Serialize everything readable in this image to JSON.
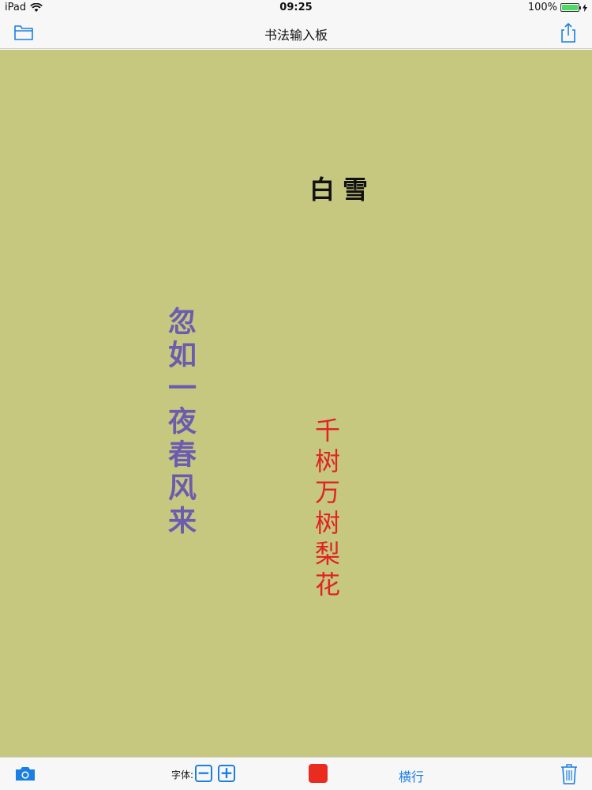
{
  "status_bar": {
    "device": "iPad",
    "time": "09:25",
    "battery": "100%",
    "battery_level": 1.0
  },
  "nav_bar": {
    "title": "书法输入板",
    "left_icon": "folder-icon",
    "right_icon": "share-icon"
  },
  "canvas": {
    "background_color": "#c6c87f",
    "title": "白雪",
    "line1": "忽如一夜春风来",
    "line1_color": "#6b5cb0",
    "line2": "千树万树梨花",
    "line2_color": "#e02424"
  },
  "toolbar": {
    "camera_icon": "camera-icon",
    "font_label": "字体:",
    "font_minus": "−",
    "font_plus": "+",
    "color_value": "#ea2b1f",
    "orientation_label": "横行",
    "trash_icon": "trash-icon"
  },
  "colors": {
    "accent": "#1a7fe3"
  }
}
